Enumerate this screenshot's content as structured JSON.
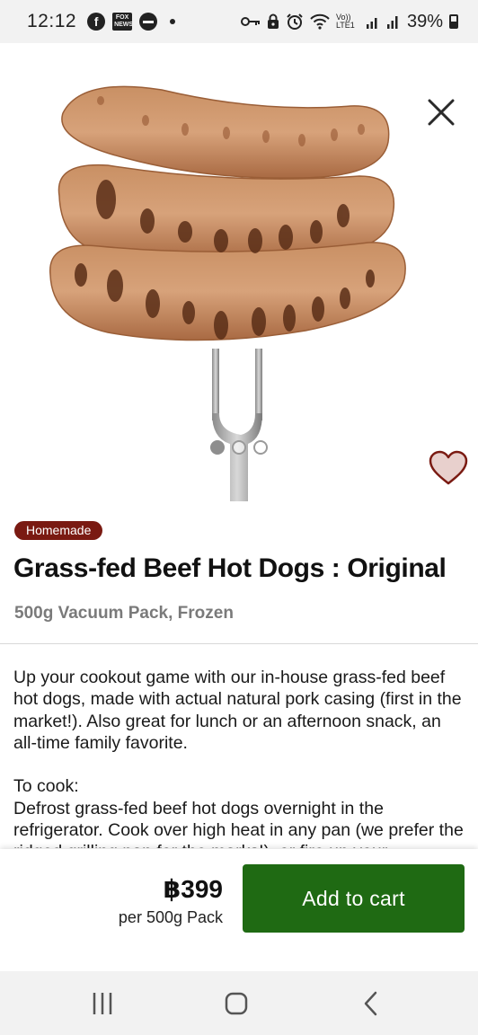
{
  "status_bar": {
    "time": "12:12",
    "battery_percent": "39%",
    "left_icons": [
      "facebook-icon",
      "fox-news-icon",
      "do-not-disturb-icon",
      "notification-dot-icon"
    ],
    "right_icons": [
      "vpn-key-icon",
      "lock-icon",
      "alarm-icon",
      "wifi-icon",
      "volte-signal-icon",
      "signal-icon",
      "battery-icon"
    ],
    "fox_news_label": "FOX NEWS",
    "volte_label": "Vo)) LTE1"
  },
  "product": {
    "image_icon": "grass-fed-beef-hot-dogs-photo",
    "badge": "Homemade",
    "title": "Grass-fed Beef Hot Dogs : Original",
    "subtitle": "500g Vacuum Pack, Frozen",
    "description": "Up your cookout game with our in-house grass-fed beef hot dogs, made with actual natural pork casing (first in the market!). Also great for lunch or an afternoon snack, an all-time family favorite.\n\nTo cook:\nDefrost grass-fed beef hot dogs overnight in the refrigerator. Cook over high heat in any pan (we prefer the ridged grilling pan for the marks!), or fire up your",
    "image_pager": {
      "count": 3,
      "active_index": 1
    },
    "favorite": false
  },
  "purchase": {
    "price": "฿399",
    "unit": "per 500g Pack",
    "add_to_cart_label": "Add to cart"
  },
  "colors": {
    "accent_green": "#1f6a13",
    "badge_maroon": "#7a1a12",
    "heart_fill": "#e8d0cd",
    "heart_stroke": "#7a1a12"
  },
  "nav_bar": {
    "buttons": [
      "recent-apps-icon",
      "home-icon",
      "back-icon"
    ]
  }
}
